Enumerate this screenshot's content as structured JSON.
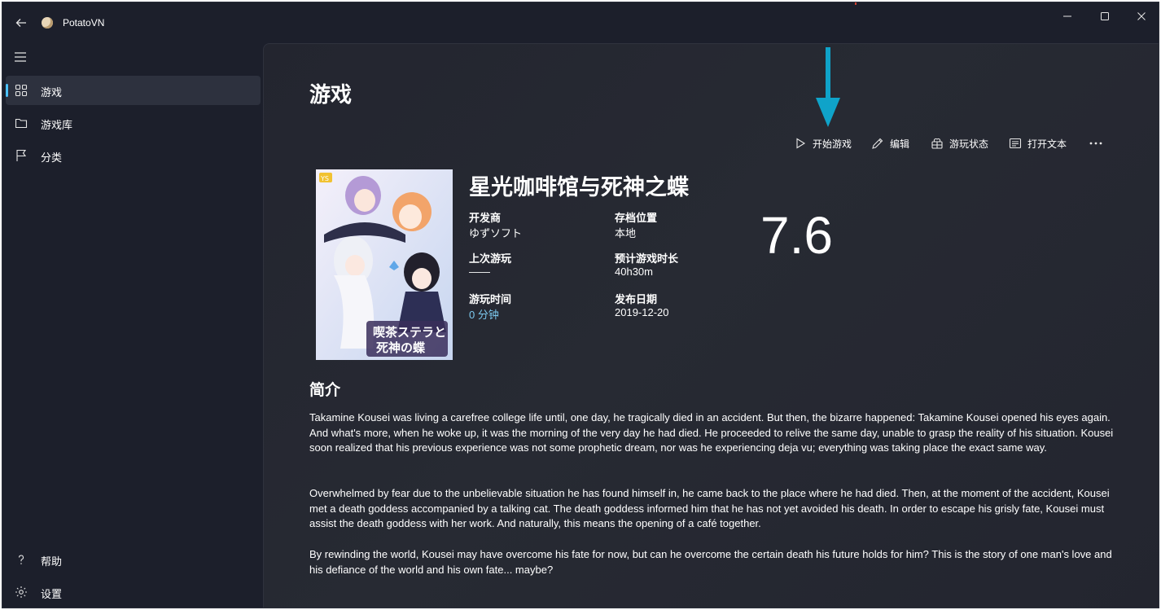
{
  "window": {
    "app_title": "PotatoVN",
    "icons": [
      "back-arrow",
      "potato-logo",
      "minimize",
      "maximize",
      "close"
    ]
  },
  "sidebar": {
    "items": [
      {
        "label": "游戏",
        "icon": "grid-icon",
        "selected": true
      },
      {
        "label": "游戏库",
        "icon": "folder-icon",
        "selected": false
      },
      {
        "label": "分类",
        "icon": "flag-icon",
        "selected": false
      }
    ],
    "footer_items": [
      {
        "label": "帮助",
        "icon": "question-icon"
      },
      {
        "label": "设置",
        "icon": "gear-icon"
      }
    ]
  },
  "page": {
    "title": "游戏"
  },
  "toolbar": {
    "start_game": "开始游戏",
    "edit": "编辑",
    "play_status": "游玩状态",
    "open_text": "打开文本",
    "more_icon": "ellipsis-icon"
  },
  "game": {
    "name": "星光咖啡馆与死神之蝶",
    "cover_title": "喫茶ステラと死神の蝶",
    "cover_logo": "YS",
    "rating": "7.6",
    "fields": {
      "developer_label": "开发商",
      "developer": "ゆずソフト",
      "save_location_label": "存档位置",
      "save_location": "本地",
      "last_played_label": "上次游玩",
      "last_played": "——",
      "estimated_time_label": "预计游戏时长",
      "estimated_time": "40h30m",
      "play_time_label": "游玩时间",
      "play_time": "0 分钟",
      "release_date_label": "发布日期",
      "release_date": "2019-12-20"
    }
  },
  "description": {
    "title": "简介",
    "paragraphs": [
      "Takamine Kousei was living a carefree college life until, one day, he tragically died in an accident. But then, the bizarre happened: Takamine Kousei opened his eyes again. And what's more, when he woke up, it was the morning of the very day he had died. He proceeded to relive the same day, unable to grasp the reality of his situation. Kousei soon realized that his previous experience was not some prophetic dream, nor was he experiencing deja vu; everything was taking place the exact same way.",
      "Overwhelmed by fear due to the unbelievable situation he has found himself in, he came back to the place where he had died. Then, at the moment of the accident, Kousei met a death goddess accompanied by a talking cat. The death goddess informed him that he has not yet avoided his death. In order to escape his grisly fate, Kousei must assist the death goddess with her work. And naturally, this means the opening of a café together.",
      "By rewinding the world, Kousei may have overcome his fate for now, but can he overcome the certain death his future holds for him? This is the story of one man's love and his defiance of the world and his own fate... maybe?"
    ]
  },
  "colors": {
    "accent": "#4cc2ff",
    "link": "#7cc9ef",
    "annotation_arrow": "#0fa3c9",
    "sidebar_bg": "#1c1f2b",
    "main_bg": "#25272f"
  }
}
